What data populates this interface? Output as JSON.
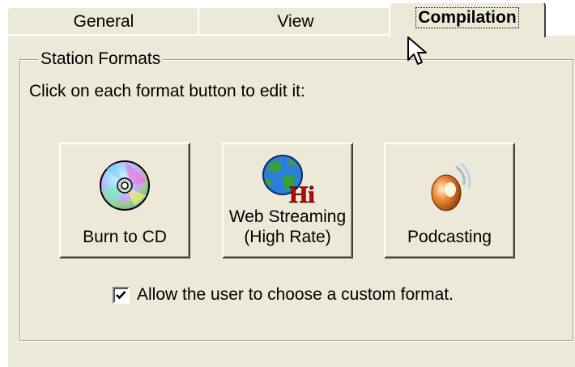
{
  "tabs": [
    {
      "label": "General",
      "active": false
    },
    {
      "label": "View",
      "active": false
    },
    {
      "label": "Compilation",
      "active": true
    }
  ],
  "group": {
    "title": "Station Formats",
    "instruction": "Click on each format button to edit it:",
    "formats": [
      {
        "label": "Burn to CD",
        "icon": "cd-disc-icon"
      },
      {
        "label": "Web Streaming\n(High Rate)",
        "icon": "globe-hi-icon"
      },
      {
        "label": "Podcasting",
        "icon": "podcast-icon"
      }
    ],
    "custom_format": {
      "label": "Allow the user to choose a custom format.",
      "checked": true
    }
  },
  "colors": {
    "dialog_bg": "#ece9d8",
    "highlight": "#ffffff",
    "shadow": "#404040",
    "hi_text": "#cc0000"
  }
}
